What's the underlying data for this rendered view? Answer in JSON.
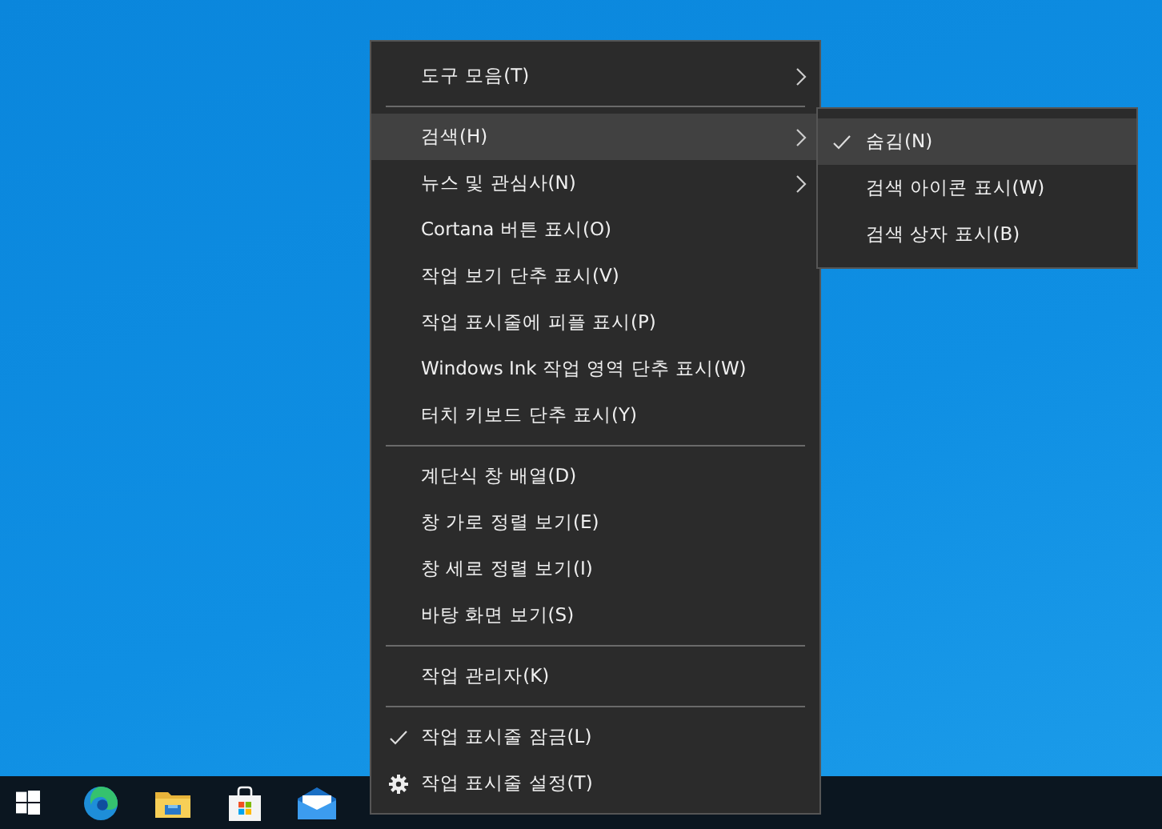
{
  "context_menu": {
    "groups": [
      [
        {
          "label": "도구 모음(T)",
          "kind": "submenu",
          "checked": false,
          "selected": false
        }
      ],
      [
        {
          "label": "검색(H)",
          "kind": "submenu",
          "checked": false,
          "selected": true
        },
        {
          "label": "뉴스 및 관심사(N)",
          "kind": "submenu",
          "checked": false,
          "selected": false
        },
        {
          "label": "Cortana 버튼 표시(O)",
          "kind": "command",
          "checked": false,
          "selected": false
        },
        {
          "label": "작업 보기 단추 표시(V)",
          "kind": "command",
          "checked": false,
          "selected": false
        },
        {
          "label": "작업 표시줄에 피플 표시(P)",
          "kind": "command",
          "checked": false,
          "selected": false
        },
        {
          "label": "Windows Ink 작업 영역 단추 표시(W)",
          "kind": "command",
          "checked": false,
          "selected": false
        },
        {
          "label": "터치 키보드 단추 표시(Y)",
          "kind": "command",
          "checked": false,
          "selected": false
        }
      ],
      [
        {
          "label": "계단식 창 배열(D)",
          "kind": "command",
          "checked": false,
          "selected": false
        },
        {
          "label": "창 가로 정렬 보기(E)",
          "kind": "command",
          "checked": false,
          "selected": false
        },
        {
          "label": "창 세로 정렬 보기(I)",
          "kind": "command",
          "checked": false,
          "selected": false
        },
        {
          "label": "바탕 화면 보기(S)",
          "kind": "command",
          "checked": false,
          "selected": false
        }
      ],
      [
        {
          "label": "작업 관리자(K)",
          "kind": "command",
          "checked": false,
          "selected": false
        }
      ],
      [
        {
          "label": "작업 표시줄 잠금(L)",
          "kind": "command",
          "checked": true,
          "selected": false
        },
        {
          "label": "작업 표시줄 설정(T)",
          "kind": "settings",
          "checked": false,
          "selected": false
        }
      ]
    ]
  },
  "submenu": {
    "items": [
      {
        "label": "숨김(N)",
        "checked": true,
        "selected": true
      },
      {
        "label": "검색 아이콘 표시(W)",
        "checked": false,
        "selected": false
      },
      {
        "label": "검색 상자 표시(B)",
        "checked": false,
        "selected": false
      }
    ]
  },
  "taskbar": {
    "items": [
      {
        "kind": "start"
      },
      {
        "kind": "edge"
      },
      {
        "kind": "explorer"
      },
      {
        "kind": "store"
      },
      {
        "kind": "mail"
      }
    ]
  }
}
